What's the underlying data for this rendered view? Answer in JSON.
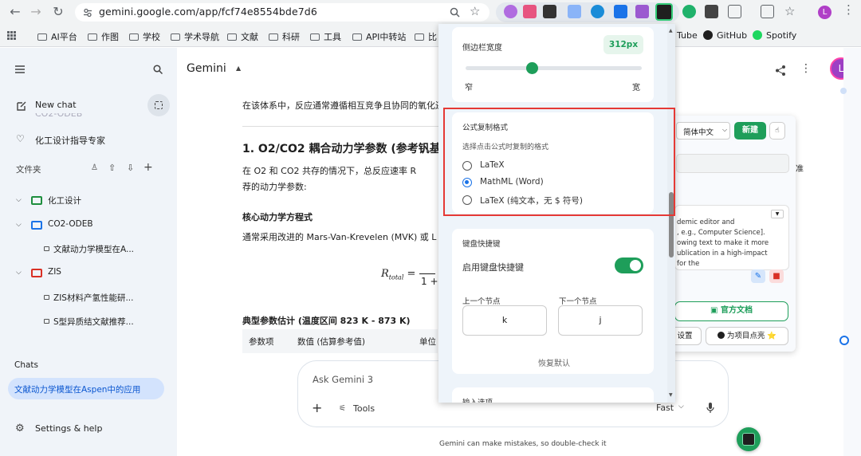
{
  "browser": {
    "url": "gemini.google.com/app/fcf74e8554bde7d6",
    "bookmarks": [
      "AI平台",
      "作图",
      "学校",
      "学术导航",
      "文献",
      "科研",
      "工具",
      "API中转站",
      "比",
      "Tube",
      "GitHub",
      "Spotify"
    ],
    "avatar_letter": "L"
  },
  "sidebar": {
    "new_chat": "New chat",
    "faded_item": "CO2-ODEB",
    "gem_item": "化工设计指导专家",
    "folders_header": "文件夹",
    "tree": [
      {
        "label": "化工设计",
        "color": "#1e8e3e"
      },
      {
        "label": "CO2-ODEB",
        "color": "#1a73e8"
      },
      {
        "label": "文献动力学模型在A...",
        "doc": true
      },
      {
        "label": "ZIS",
        "color": "#d93025"
      },
      {
        "label": "ZIS材料产氢性能研...",
        "doc": true
      },
      {
        "label": "S型异质结文献推荐...",
        "doc": true
      }
    ],
    "chats_header": "Chats",
    "active_chat": "文献动力学模型在Aspen中的应用",
    "settings": "Settings & help"
  },
  "main": {
    "title": "Gemini",
    "intro": "在该体系中，反应通常遵循相互竞争且协同的氧化还",
    "heading": "1. O2/CO2 耦合动力学参数 (参考钒基",
    "para_1": "在 O2 和 CO2 共存的情况下，总反应速率 R",
    "para_2": "荐的动力学参数:",
    "eq_heading": "核心动力学方程式",
    "eq_text": "通常采用改进的 Mars-Van-Krevelen (MVK) 或 L",
    "table_heading": "典型参数估计 (温度区间 823 K - 873 K)",
    "table_cols": [
      "参数项",
      "数值 (估算参考值)",
      "单位"
    ],
    "chat_placeholder": "Ask Gemini 3",
    "tools_label": "Tools",
    "mode_label": "Fast",
    "disclaimer": "Gemini can make mistakes, so double-check it"
  },
  "popup": {
    "width_label": "侧边栏宽度",
    "width_value": "312px",
    "slider_fraction": 0.38,
    "slider_min": "窄",
    "slider_max": "宽",
    "formula_title": "公式复制格式",
    "formula_desc": "选择点击公式时复制的格式",
    "options": [
      "LaTeX",
      "MathML (Word)",
      "LaTeX (纯文本，无 $ 符号)"
    ],
    "selected_option": "MathML (Word)",
    "kb_title": "键盘快捷键",
    "kb_toggle_label": "启用键盘快捷键",
    "kb_enabled": true,
    "prev_label": "上一个节点",
    "next_label": "下一个节点",
    "prev_key": "k",
    "next_key": "j",
    "reset": "恢复默认",
    "more": "输入选项"
  },
  "right_panel": {
    "lang": "简体中文",
    "new_btn": "新建",
    "prompt_lines": [
      "demic editor and",
      ", e.g., Computer Science].",
      "owing text to make it more",
      "ublication in a high-impact",
      "for the"
    ],
    "docs_btn": "官方文档",
    "settings_btn": "设置",
    "star_btn": "为项目点亮 ⭐",
    "edge_text": "准"
  },
  "colors": {
    "accent_green": "#1e9e5a",
    "selected_blue": "#1a73e8",
    "highlight_red": "#e53935"
  }
}
